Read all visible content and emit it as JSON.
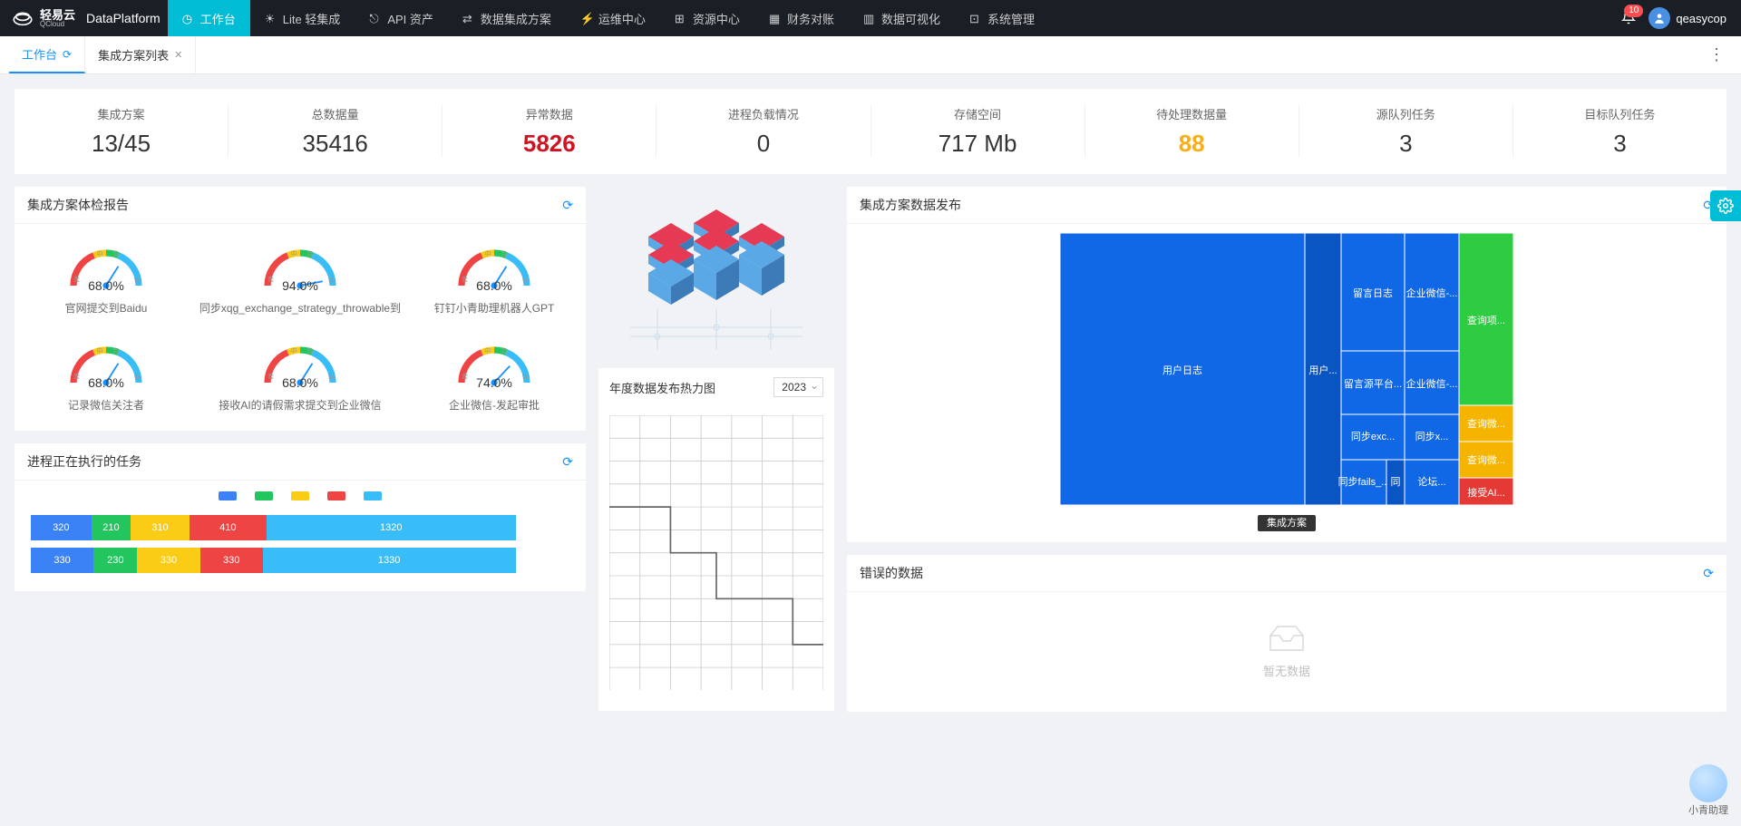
{
  "header": {
    "brand_cn": "轻易云",
    "brand_en": "QCloud",
    "product": "DataPlatform",
    "nav": [
      {
        "label": "工作台",
        "icon": "reload"
      },
      {
        "label": "Lite 轻集成",
        "icon": "lite"
      },
      {
        "label": "API 资产",
        "icon": "api"
      },
      {
        "label": "数据集成方案",
        "icon": "flow"
      },
      {
        "label": "运维中心",
        "icon": "ops"
      },
      {
        "label": "资源中心",
        "icon": "resource"
      },
      {
        "label": "财务对账",
        "icon": "finance"
      },
      {
        "label": "数据可视化",
        "icon": "chart"
      },
      {
        "label": "系统管理",
        "icon": "settings"
      }
    ],
    "active_nav": 0,
    "notifications": "10",
    "username": "qeasycop"
  },
  "tabs": [
    {
      "label": "工作台",
      "active": true,
      "closable": false
    },
    {
      "label": "集成方案列表",
      "active": false,
      "closable": true
    }
  ],
  "stats": [
    {
      "label": "集成方案",
      "value": "13/45",
      "tone": "normal"
    },
    {
      "label": "总数据量",
      "value": "35416",
      "tone": "normal"
    },
    {
      "label": "异常数据",
      "value": "5826",
      "tone": "danger"
    },
    {
      "label": "进程负载情况",
      "value": "0",
      "tone": "normal"
    },
    {
      "label": "存储空间",
      "value": "717 Mb",
      "tone": "normal"
    },
    {
      "label": "待处理数据量",
      "value": "88",
      "tone": "warn"
    },
    {
      "label": "源队列任务",
      "value": "3",
      "tone": "normal"
    },
    {
      "label": "目标队列任务",
      "value": "3",
      "tone": "normal"
    }
  ],
  "health": {
    "title": "集成方案体检报告",
    "items": [
      {
        "pct": "68.0%",
        "pct_num": 68.0,
        "label": "官网提交到Baidu"
      },
      {
        "pct": "94.0%",
        "pct_num": 94.0,
        "label": "同步xqg_exchange_strategy_throwable到"
      },
      {
        "pct": "68.0%",
        "pct_num": 68.0,
        "label": "钉钉小青助理机器人GPT"
      },
      {
        "pct": "68.0%",
        "pct_num": 68.0,
        "label": "记录微信关注者"
      },
      {
        "pct": "68.0%",
        "pct_num": 68.0,
        "label": "接收AI的请假需求提交到企业微信"
      },
      {
        "pct": "74.0%",
        "pct_num": 74.0,
        "label": "企业微信-发起审批"
      }
    ],
    "gauge_marks": {
      "bad": "差",
      "mid": "中",
      "good": "良",
      "best": "优"
    }
  },
  "heatmap": {
    "title": "年度数据发布热力图",
    "year": "2023"
  },
  "treemap": {
    "title": "集成方案数据发布",
    "footer": "集成方案",
    "items": [
      {
        "name": "用户日志",
        "color": "#1068e6"
      },
      {
        "name": "用户...",
        "color": "#1068e6"
      },
      {
        "name": "留言日志",
        "color": "#1068e6"
      },
      {
        "name": "留言源平台...",
        "color": "#1068e6"
      },
      {
        "name": "同步exc...",
        "color": "#1068e6"
      },
      {
        "name": "同步fails_...",
        "color": "#1068e6"
      },
      {
        "name": "同",
        "color": "#1068e6"
      },
      {
        "name": "企业微信-...",
        "color": "#1068e6"
      },
      {
        "name": "企业微信-...",
        "color": "#1068e6"
      },
      {
        "name": "同步x...",
        "color": "#1068e6"
      },
      {
        "name": "论坛...",
        "color": "#1068e6"
      },
      {
        "name": "查询项...",
        "color": "#2ecc40"
      },
      {
        "name": "查询微...",
        "color": "#f5b400"
      },
      {
        "name": "查询微...",
        "color": "#f5b400"
      },
      {
        "name": "接受AI...",
        "color": "#e53935"
      }
    ]
  },
  "progress": {
    "title": "进程正在执行的任务",
    "colors": [
      "#3b82f6",
      "#22c55e",
      "#facc15",
      "#ef4444",
      "#38bdf8"
    ]
  },
  "errors": {
    "title": "错误的数据",
    "empty": "暂无数据"
  },
  "assistant": {
    "label": "小青助理"
  },
  "chart_data": {
    "gauges": {
      "type": "gauge",
      "range": [
        0,
        100
      ],
      "segments": [
        "差",
        "中",
        "良",
        "优"
      ],
      "items": [
        {
          "label": "官网提交到Baidu",
          "value": 68.0
        },
        {
          "label": "同步xqg_exchange_strategy_throwable到",
          "value": 94.0
        },
        {
          "label": "钉钉小青助理机器人GPT",
          "value": 68.0
        },
        {
          "label": "记录微信关注者",
          "value": 68.0
        },
        {
          "label": "接收AI的请假需求提交到企业微信",
          "value": 68.0
        },
        {
          "label": "企业微信-发起审批",
          "value": 74.0
        }
      ]
    },
    "progress_bars": {
      "type": "bar",
      "stacked": true,
      "orientation": "horizontal",
      "legend_position": "top",
      "series_colors": [
        "#3b82f6",
        "#22c55e",
        "#facc15",
        "#ef4444",
        "#38bdf8"
      ],
      "rows": [
        {
          "values": [
            320,
            210,
            310,
            410,
            1320
          ]
        },
        {
          "values": [
            330,
            230,
            330,
            330,
            1330
          ]
        }
      ]
    },
    "heatmap": {
      "type": "heatmap",
      "title": "年度数据发布热力图",
      "year": 2023,
      "note": "grid shown without per-cell values; step-line overlay visible"
    },
    "treemap": {
      "type": "treemap",
      "title": "集成方案",
      "items": [
        {
          "name": "用户日志",
          "group": "blue",
          "size_est": 40
        },
        {
          "name": "用户...",
          "group": "blue",
          "size_est": 6
        },
        {
          "name": "留言日志",
          "group": "blue",
          "size_est": 6
        },
        {
          "name": "留言源平台...",
          "group": "blue",
          "size_est": 5
        },
        {
          "name": "同步exc...",
          "group": "blue",
          "size_est": 5
        },
        {
          "name": "同步fails_...",
          "group": "blue",
          "size_est": 4
        },
        {
          "name": "同",
          "group": "blue",
          "size_est": 1.5
        },
        {
          "name": "企业微信-...",
          "group": "blue",
          "size_est": 5
        },
        {
          "name": "企业微信-...",
          "group": "blue",
          "size_est": 5
        },
        {
          "name": "同步x...",
          "group": "blue",
          "size_est": 3
        },
        {
          "name": "论坛...",
          "group": "blue",
          "size_est": 2
        },
        {
          "name": "查询项...",
          "group": "green",
          "size_est": 10
        },
        {
          "name": "查询微...",
          "group": "yellow",
          "size_est": 2.5
        },
        {
          "name": "查询微...",
          "group": "yellow",
          "size_est": 2.5
        },
        {
          "name": "接受AI...",
          "group": "red",
          "size_est": 1.5
        }
      ]
    }
  }
}
